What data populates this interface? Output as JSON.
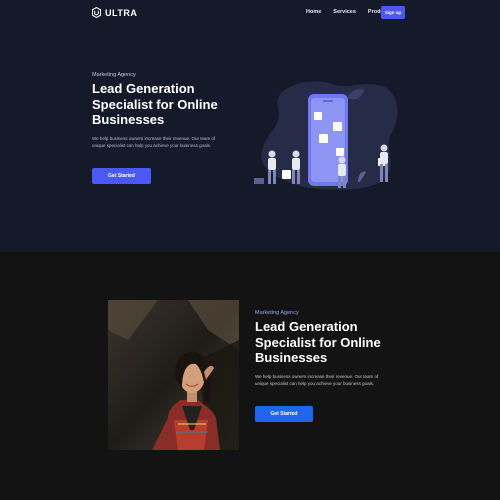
{
  "nav": {
    "logo_text": "ULTRA",
    "links": [
      "Home",
      "Services",
      "Products"
    ],
    "signup_label": "Sign up"
  },
  "hero": {
    "eyebrow": "Marketing Agency",
    "title": "Lead Generation Specialist for Online Businesses",
    "description": "We help business owners increase their revenue. Our team of unique specialist can help you achieve your business goals.",
    "cta_label": "Get Started",
    "illustration_icon": "mobile-app-team-illustration"
  },
  "feature": {
    "eyebrow": "Marketing Agency",
    "title": "Lead Generation Specialist for Online Businesses",
    "description": "We help business owners increase their revenue. Our team of unique specialist can help you achieve your business goals.",
    "cta_label": "Get Started",
    "photo_icon": "woman-portrait-photo"
  },
  "colors": {
    "hero_bg": "#151a2b",
    "section_bg": "#131313",
    "accent_primary": "#4c58f5",
    "accent_blue": "#1c66f2",
    "eyebrow_accent": "#9aa6ff"
  }
}
